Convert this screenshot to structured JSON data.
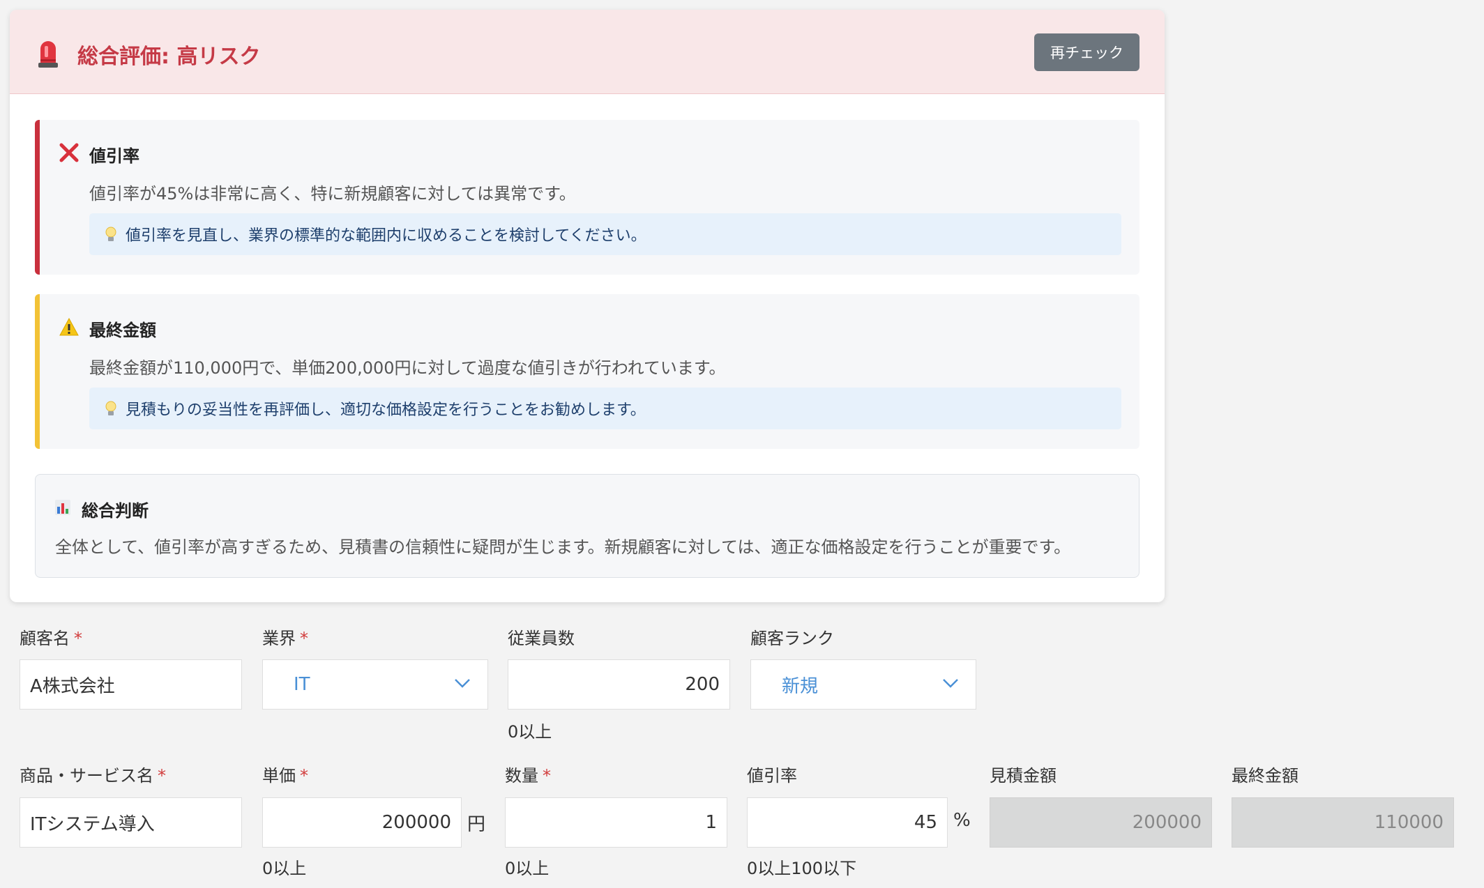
{
  "assessment": {
    "title": "総合評価: 高リスク",
    "recheck_label": "再チェック",
    "accent_color": "#c53a46",
    "issues": [
      {
        "severity": "error",
        "icon": "cross-icon",
        "bar_color": "#c9303d",
        "title": "値引率",
        "description": "値引率が45%は非常に高く、特に新規顧客に対しては異常です。",
        "tip": "値引率を見直し、業界の標準的な範囲内に収めることを検討してください。"
      },
      {
        "severity": "warning",
        "icon": "warning-icon",
        "bar_color": "#f2c236",
        "title": "最終金額",
        "description": "最終金額が110,000円で、単価200,000円に対して過度な値引きが行われています。",
        "tip": "見積もりの妥当性を再評価し、適切な価格設定を行うことをお勧めします。"
      }
    ],
    "summary": {
      "title": "総合判断",
      "text": "全体として、値引率が高すぎるため、見積書の信頼性に疑問が生じます。新規顧客に対しては、適正な価格設定を行うことが重要です。"
    }
  },
  "form": {
    "customer_name": {
      "label": "顧客名",
      "required": "*",
      "value": "A株式会社"
    },
    "industry": {
      "label": "業界",
      "required": "*",
      "value": "IT"
    },
    "employees": {
      "label": "従業員数",
      "value": "200",
      "hint": "0以上"
    },
    "customer_rank": {
      "label": "顧客ランク",
      "value": "新規"
    },
    "product": {
      "label": "商品・サービス名",
      "required": "*",
      "value": "ITシステム導入"
    },
    "unit_price": {
      "label": "単価",
      "required": "*",
      "value": "200000",
      "unit": "円",
      "hint": "0以上"
    },
    "quantity": {
      "label": "数量",
      "required": "*",
      "value": "1",
      "hint": "0以上"
    },
    "discount": {
      "label": "値引率",
      "value": "45",
      "unit": "%",
      "hint": "0以上100以下"
    },
    "estimate_amount": {
      "label": "見積金額",
      "value": "200000"
    },
    "final_amount": {
      "label": "最終金額",
      "value": "110000"
    }
  }
}
